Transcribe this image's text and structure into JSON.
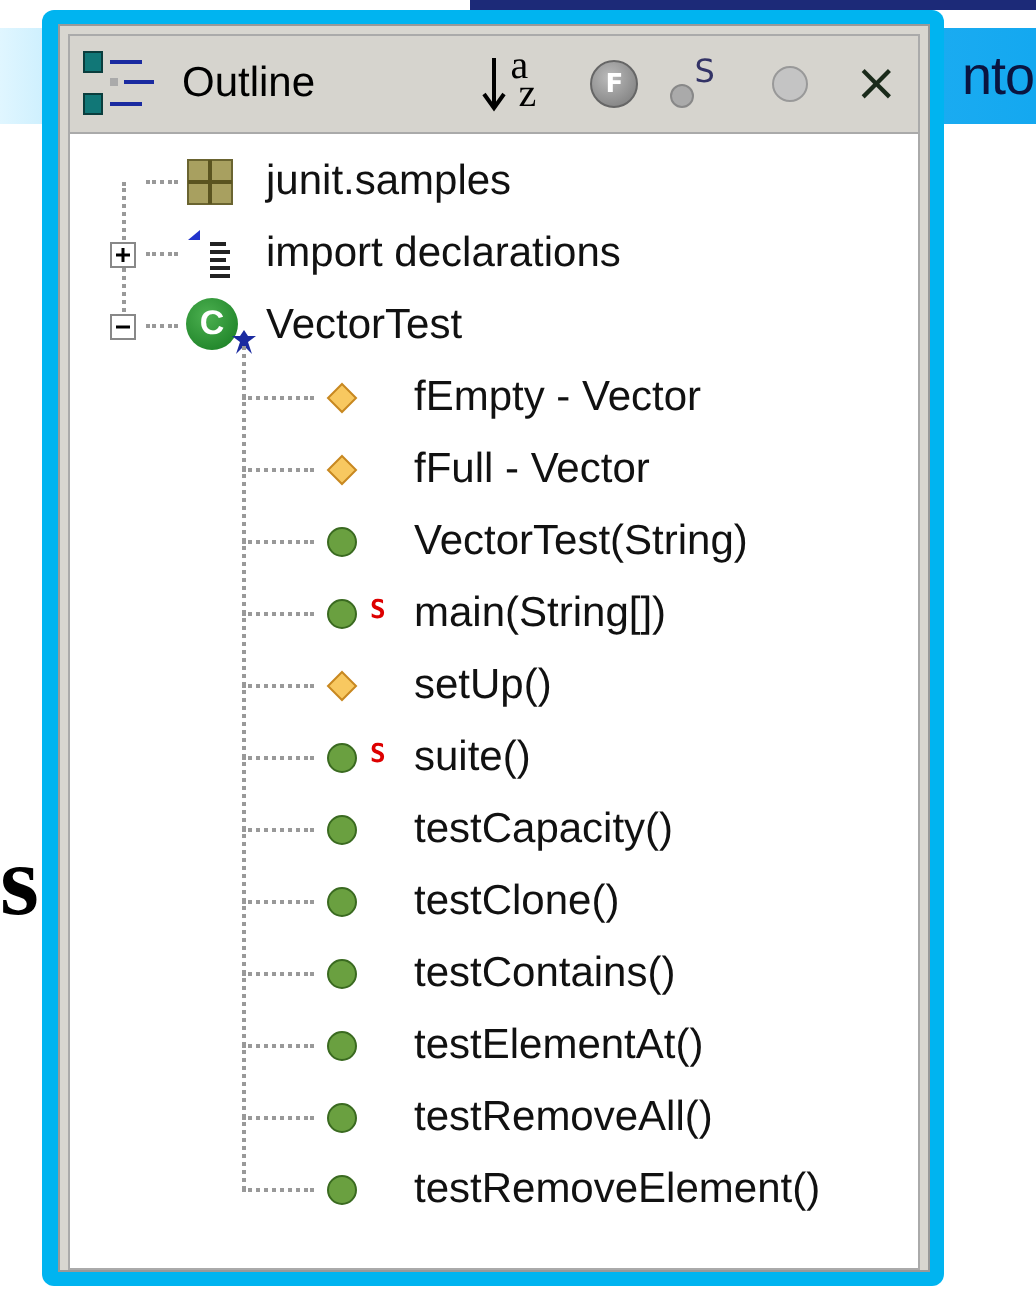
{
  "slide": {
    "header_fragment": "nto",
    "side_fragment": "s"
  },
  "view": {
    "title": "Outline",
    "close": "×",
    "toolbar": [
      {
        "kind": "sort",
        "glyphs": [
          "a",
          "z"
        ]
      },
      {
        "kind": "hide-fields",
        "glyph": "F"
      },
      {
        "kind": "hide-static",
        "glyph": "S"
      },
      {
        "kind": "hide-nonpublic"
      }
    ]
  },
  "tree": [
    {
      "label": "junit.samples",
      "kind": "package"
    },
    {
      "label": "import declarations",
      "kind": "imports",
      "expanded": false
    },
    {
      "label": "VectorTest",
      "kind": "class",
      "icon_letter": "C",
      "expanded": true,
      "children": [
        {
          "label": "fEmpty - Vector",
          "kind": "field"
        },
        {
          "label": "fFull - Vector",
          "kind": "field"
        },
        {
          "label": "VectorTest(String)",
          "kind": "method"
        },
        {
          "label": "main(String[])",
          "kind": "method",
          "badge": "S"
        },
        {
          "label": "setUp()",
          "kind": "field"
        },
        {
          "label": "suite()",
          "kind": "method",
          "badge": "S"
        },
        {
          "label": "testCapacity()",
          "kind": "method"
        },
        {
          "label": "testClone()",
          "kind": "method"
        },
        {
          "label": "testContains()",
          "kind": "method"
        },
        {
          "label": "testElementAt()",
          "kind": "method"
        },
        {
          "label": "testRemoveAll()",
          "kind": "method"
        },
        {
          "label": "testRemoveElement()",
          "kind": "method"
        }
      ]
    }
  ]
}
